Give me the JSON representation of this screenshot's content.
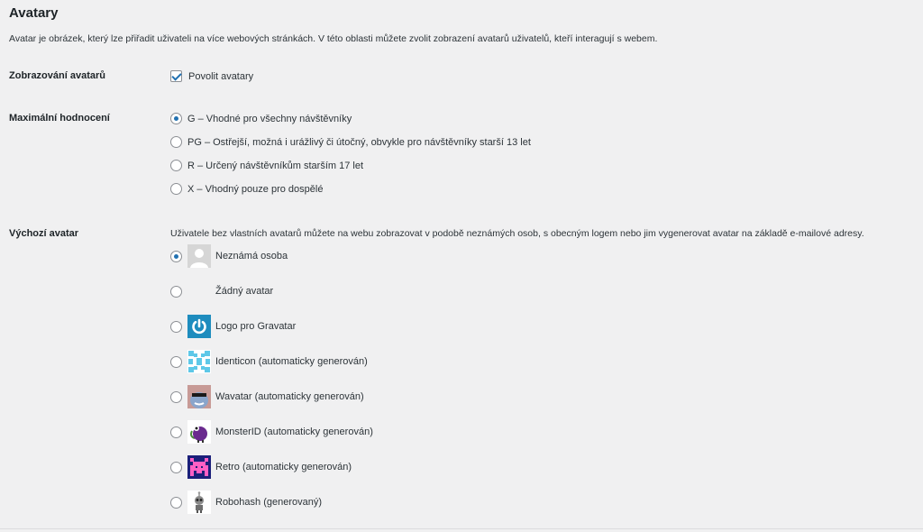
{
  "section": {
    "title": "Avatary",
    "description": "Avatar je obrázek, který lze přiřadit uživateli na více webových stránkách. V této oblasti můžete zvolit zobrazení avatarů uživatelů, kteří interagují s webem."
  },
  "show_avatars": {
    "label": "Zobrazování avatarů",
    "checkbox_label": "Povolit avatary",
    "checked": true
  },
  "rating": {
    "label": "Maximální hodnocení",
    "selected": "G",
    "options": [
      {
        "value": "G",
        "label": "G – Vhodné pro všechny návštěvníky"
      },
      {
        "value": "PG",
        "label": "PG – Ostřejší, možná i urážlivý či útočný, obvykle pro návštěvníky starší 13 let"
      },
      {
        "value": "R",
        "label": "R – Určený návštěvníkům starším 17 let"
      },
      {
        "value": "X",
        "label": "X – Vhodný pouze pro dospělé"
      }
    ]
  },
  "default_avatar": {
    "label": "Výchozí avatar",
    "description": "Uživatele bez vlastních avatarů můžete na webu zobrazovat v podobě neznámých osob, s obecným logem nebo jim vygenerovat avatar na základě e-mailové adresy.",
    "selected": "mystery",
    "options": [
      {
        "value": "mystery",
        "label": "Neznámá osoba",
        "icon": "mystery-person-icon"
      },
      {
        "value": "blank",
        "label": "Žádný avatar",
        "icon": "blank-avatar-icon"
      },
      {
        "value": "gravatar_default",
        "label": "Logo pro Gravatar",
        "icon": "gravatar-logo-icon"
      },
      {
        "value": "identicon",
        "label": "Identicon (automaticky generován)",
        "icon": "identicon-icon"
      },
      {
        "value": "wavatar",
        "label": "Wavatar (automaticky generován)",
        "icon": "wavatar-icon"
      },
      {
        "value": "monsterid",
        "label": "MonsterID (automaticky generován)",
        "icon": "monsterid-icon"
      },
      {
        "value": "retro",
        "label": "Retro (automaticky generován)",
        "icon": "retro-icon"
      },
      {
        "value": "robohash",
        "label": "Robohash (generovaný)",
        "icon": "robohash-icon"
      }
    ]
  },
  "colors": {
    "background": "#f0f0f1",
    "accent": "#2271b1",
    "text": "#1d2327"
  }
}
